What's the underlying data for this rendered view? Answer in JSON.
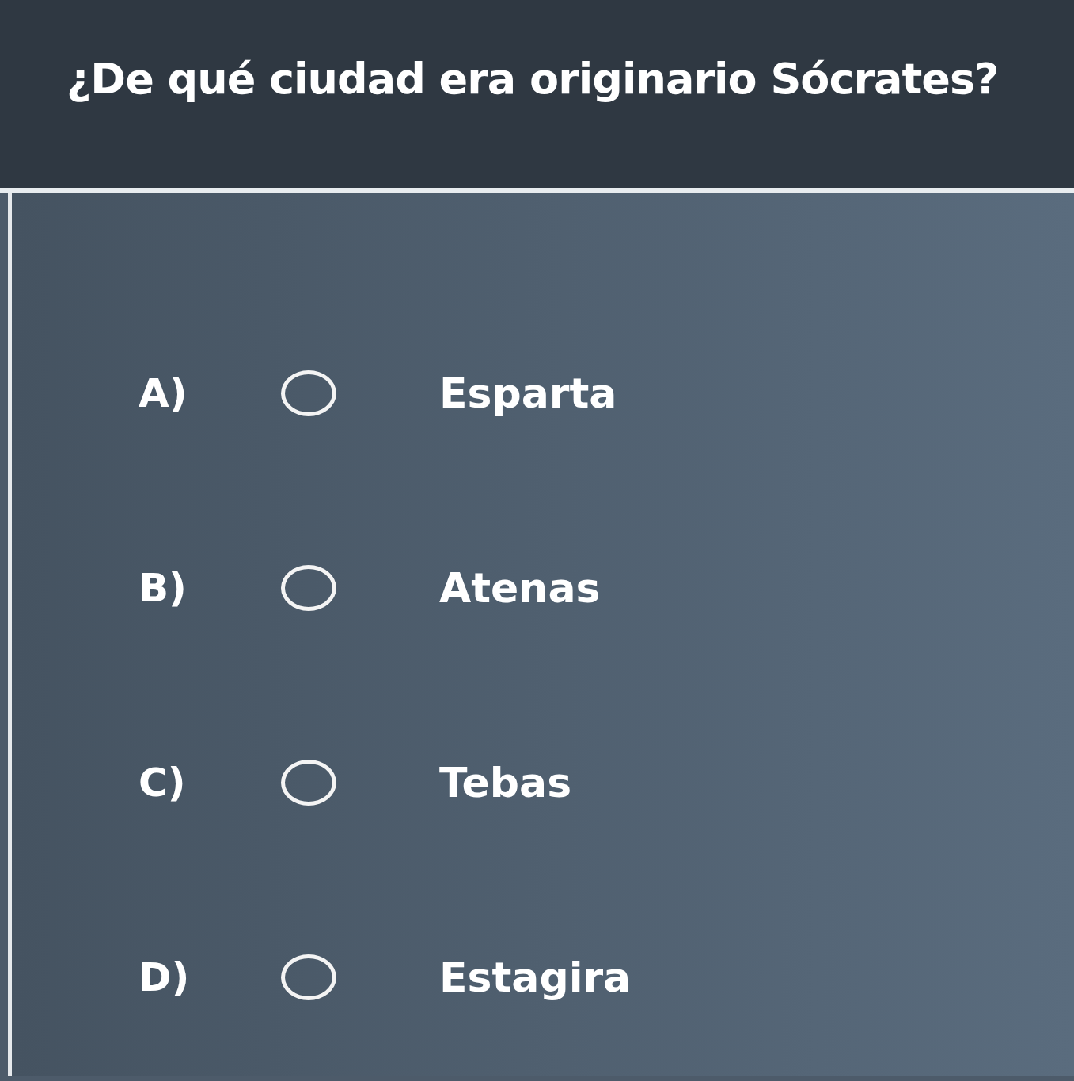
{
  "question": "¿De qué ciudad era originario Sócrates?",
  "options": [
    {
      "letter": "A)",
      "label": "Esparta",
      "selected": false
    },
    {
      "letter": "B)",
      "label": "Atenas",
      "selected": false
    },
    {
      "letter": "C)",
      "label": "Tebas",
      "selected": false
    },
    {
      "letter": "D)",
      "label": "Estagira",
      "selected": false
    }
  ]
}
